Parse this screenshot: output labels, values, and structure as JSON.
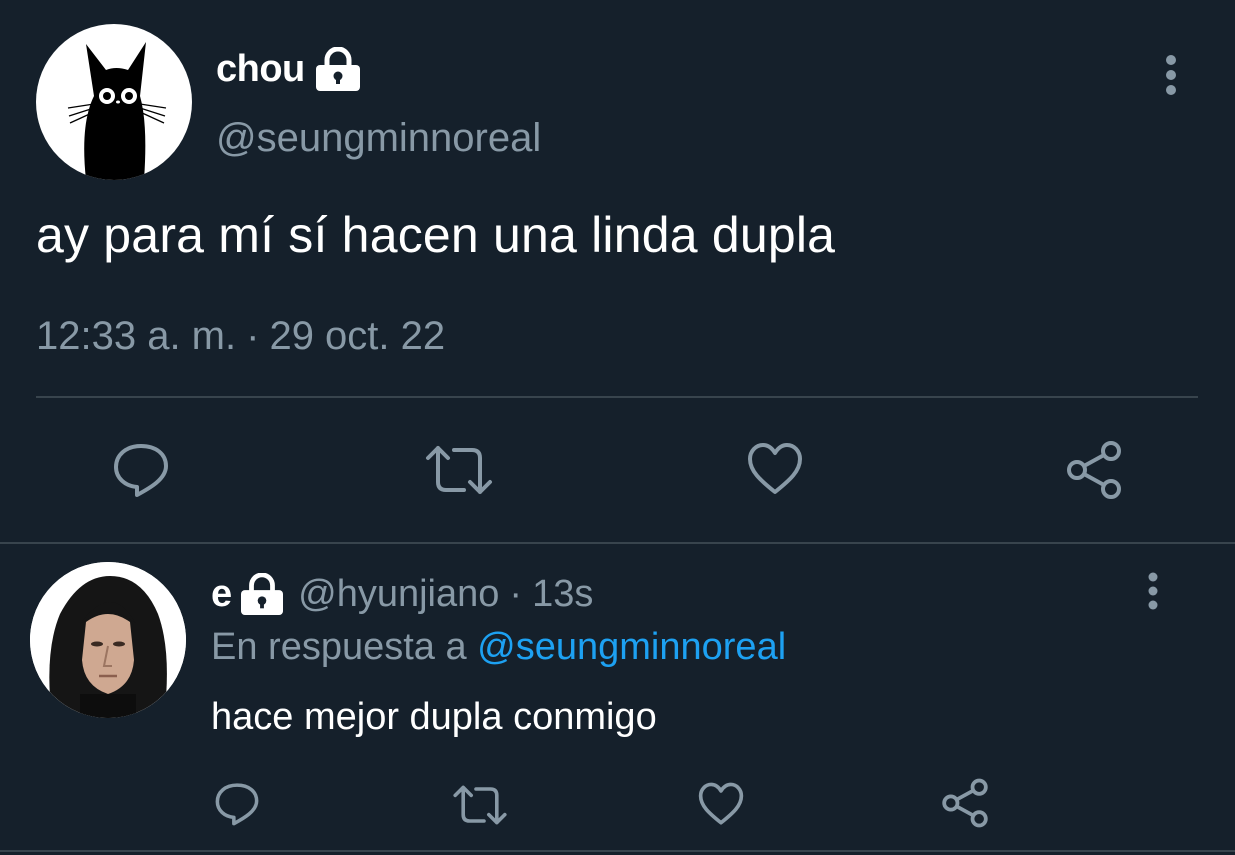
{
  "main_tweet": {
    "display_name": "chou",
    "handle": "@seungminnoreal",
    "text": "ay para mí sí hacen una linda dupla",
    "time": "12:33 a. m.",
    "separator": "·",
    "date": "29 oct. 22",
    "actions": [
      "reply-icon",
      "retweet-icon",
      "like-icon",
      "share-icon"
    ]
  },
  "reply": {
    "display_name": "e",
    "handle": "@hyunjiano",
    "separator": "·",
    "time": "13s",
    "replying_to_label": "En respuesta a",
    "replying_to_handle": "@seungminnoreal",
    "text": "hace mejor dupla conmigo",
    "actions": [
      "reply-icon",
      "retweet-icon",
      "like-icon",
      "share-icon"
    ]
  },
  "colors": {
    "background": "#15202b",
    "primary_text": "#ffffff",
    "secondary_text": "#8899a6",
    "link": "#1da1f2",
    "divider": "#38444d"
  }
}
